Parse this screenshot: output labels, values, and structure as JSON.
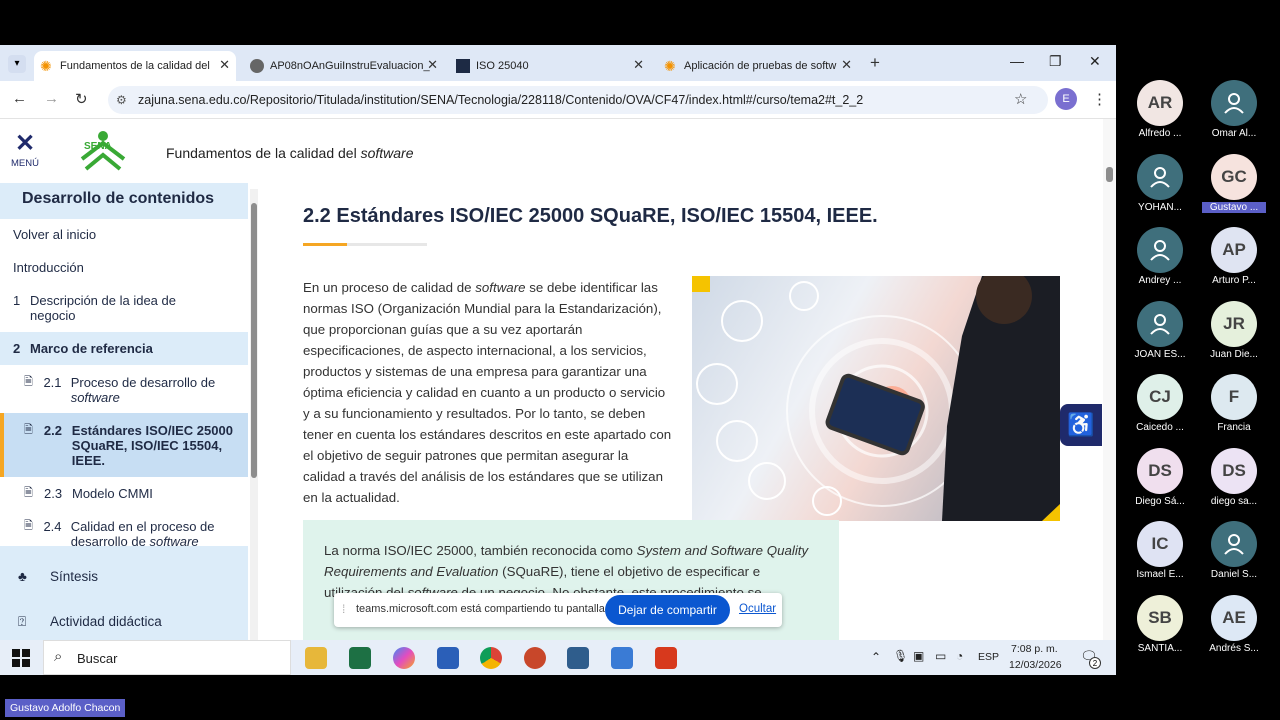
{
  "browser": {
    "tabs": [
      {
        "label": "Fundamentos de la calidad del",
        "active": true
      },
      {
        "label": "AP08nOAnGuiInstruEvaluacion_",
        "active": false
      },
      {
        "label": "ISO 25040",
        "active": false
      },
      {
        "label": "Aplicación de pruebas de softw",
        "active": false
      }
    ],
    "new_tab": "+",
    "url": "zajuna.sena.edu.co/Repositorio/Titulada/institution/SENA/Tecnologia/228118/Contenido/OVA/CF47/index.html#/curso/tema2#t_2_2",
    "profile_initial": "E"
  },
  "header": {
    "menu_label": "MENÚ",
    "logo_text": "SENA",
    "course_title": "Fundamentos de la calidad del",
    "course_title_em": "software"
  },
  "sidebar": {
    "heading": "Desarrollo de contenidos",
    "items": [
      {
        "label": "Volver al inicio"
      },
      {
        "label": "Introducción"
      },
      {
        "num": "1",
        "label": "Descripción de la idea de negocio"
      },
      {
        "num": "2",
        "label": "Marco de referencia"
      },
      {
        "num": "2.1",
        "label": "Proceso de desarrollo de",
        "em": "software"
      },
      {
        "num": "2.2",
        "label": "Estándares ISO/IEC 25000 SQuaRE, ISO/IEC 15504, IEEE."
      },
      {
        "num": "2.3",
        "label": "Modelo CMMI"
      },
      {
        "num": "2.4",
        "label": "Calidad en el proceso de desarrollo de",
        "em": "software"
      }
    ],
    "bottom": [
      {
        "label": "Síntesis"
      },
      {
        "label": "Actividad didáctica"
      }
    ]
  },
  "content": {
    "title": "2.2 Estándares ISO/IEC 25000 SQuaRE, ISO/IEC 15504, IEEE.",
    "para1_a": "En un proceso de calidad de",
    "para1_em": "software",
    "para1_b": "se debe identificar las normas ISO (Organización Mundial para la Estandarización), que proporcionan guías que a su vez aportarán especificaciones, de aspecto internacional, a los servicios, productos y sistemas de una empresa para garantizar una óptima eficiencia y calidad en cuanto a un producto o servicio y a su funcionamiento y resultados. Por lo tanto, se deben tener en cuenta los estándares descritos en este apartado con el objetivo de seguir patrones que permitan asegurar la calidad a través del análisis de los estándares que se utilizan en la actualidad.",
    "box_a": "La norma ISO/IEC 25000, también reconocida como",
    "box_em": "System and Software Quality Requirements and Evaluation",
    "box_b": "(SQuaRE), tiene el objetivo de especificar e",
    "box_c": "utilización del",
    "box_em2": "software",
    "box_d": "de un negocio. No obstante, este procedimiento se"
  },
  "share_bar": {
    "message": "teams.microsoft.com está compartiendo tu pantalla.",
    "stop_button": "Dejar de compartir",
    "hide_link": "Ocultar"
  },
  "taskbar": {
    "search_placeholder": "Buscar",
    "lang": "ESP",
    "time": "7:08 p. m.",
    "date": "12/03/2026",
    "notif_count": "2"
  },
  "participants": [
    {
      "initials": "AR",
      "name": "Alfredo ...",
      "color": "#f1e6e3"
    },
    {
      "initials": "",
      "name": "Omar Al...",
      "color": "#3f6f7c"
    },
    {
      "initials": "",
      "name": "YOHAN...",
      "color": "#3f6f7c"
    },
    {
      "initials": "GC",
      "name": "Gustavo ...",
      "color": "#f6e3de"
    },
    {
      "initials": "",
      "name": "Andrey ...",
      "color": "#3f6f7c"
    },
    {
      "initials": "AP",
      "name": "Arturo P...",
      "color": "#dfe4f2"
    },
    {
      "initials": "",
      "name": "JOAN ES...",
      "color": "#3f6f7c"
    },
    {
      "initials": "JR",
      "name": "Juan Die...",
      "color": "#e5f0dc"
    },
    {
      "initials": "CJ",
      "name": "Caicedo ...",
      "color": "#dff0e9"
    },
    {
      "initials": "F",
      "name": "Francia",
      "color": "#dde9f0"
    },
    {
      "initials": "DS",
      "name": "Diego Sá...",
      "color": "#f0dfee"
    },
    {
      "initials": "DS",
      "name": "diego sa...",
      "color": "#ece3f4"
    },
    {
      "initials": "IC",
      "name": "Ismael E...",
      "color": "#dfe3f3"
    },
    {
      "initials": "",
      "name": "Daniel S...",
      "color": "#3f6f7c"
    },
    {
      "initials": "SB",
      "name": "SANTIA...",
      "color": "#eef0d9"
    },
    {
      "initials": "AE",
      "name": "Andrés S...",
      "color": "#dde8f5"
    }
  ],
  "presenter_label": "Gustavo Adolfo Chacon"
}
